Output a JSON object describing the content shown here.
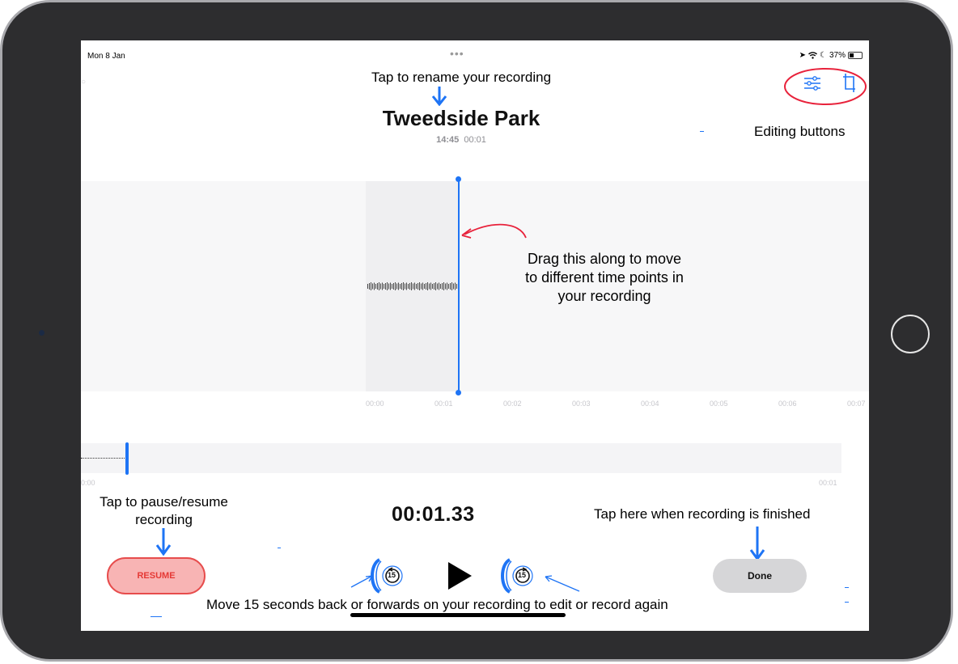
{
  "status_bar": {
    "date": "Mon 8 Jan",
    "dots": "•••",
    "battery": "37%",
    "battery_level": 0.37
  },
  "recording": {
    "title": "Tweedside Park",
    "time": "14:45",
    "duration": "00:01"
  },
  "timeline": {
    "ticks": [
      "00:00",
      "00:01",
      "00:02",
      "00:03",
      "00:04",
      "00:05",
      "00:06",
      "00:07"
    ]
  },
  "overview": {
    "start": "0:00",
    "end": "00:01"
  },
  "playback": {
    "timer": "00:01.33",
    "skip_back": "15",
    "skip_forward": "15"
  },
  "buttons": {
    "resume": "RESUME",
    "done": "Done"
  },
  "annotations": {
    "rename": "Tap to rename your recording",
    "editing": "Editing buttons",
    "drag": [
      "Drag this along to move",
      "to different time points in",
      "your recording"
    ],
    "pause": [
      "Tap to pause/resume",
      "recording"
    ],
    "finished": "Tap here when recording is finished",
    "skip": "Move 15 seconds back or forwards on your recording to edit or record again"
  },
  "colors": {
    "accent": "#1e74f5",
    "resume_red": "#e53935",
    "annotation_red": "#e8223b"
  }
}
